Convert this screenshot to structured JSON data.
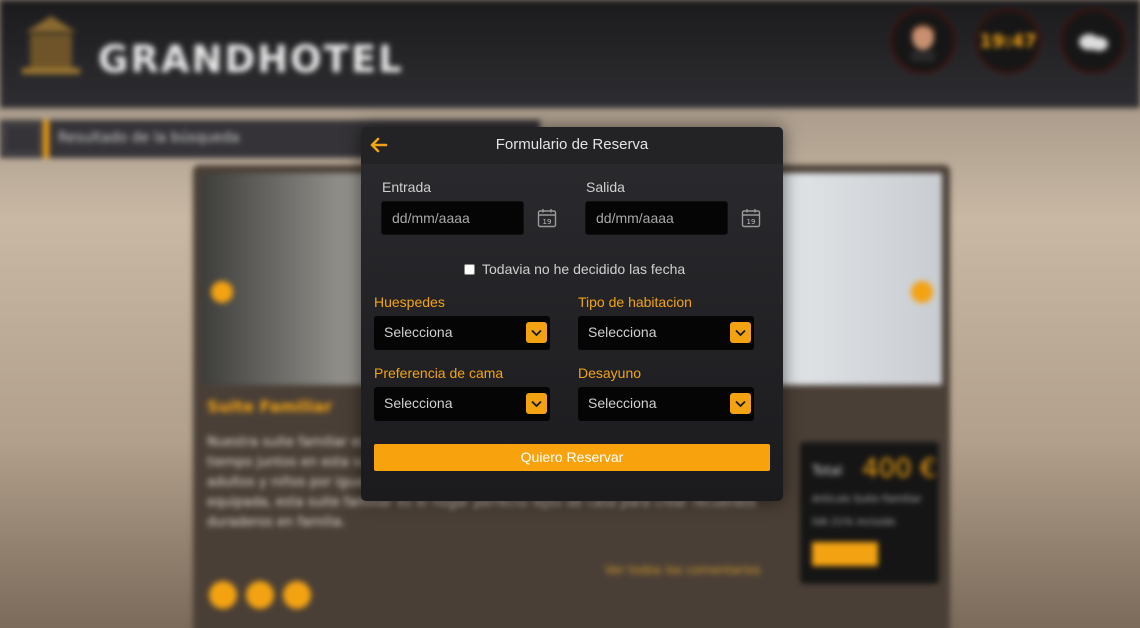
{
  "header": {
    "brand": "GRANDHOTEL",
    "widgets": [
      {
        "name": "user",
        "caption": ""
      },
      {
        "name": "clock",
        "value": "19:47",
        "caption": ""
      },
      {
        "name": "weather",
        "caption": ""
      }
    ]
  },
  "background": {
    "results_label": "Resultado de la búsqueda",
    "room_title": "Suite Familiar",
    "description": "Nuestra suite familiar es perfecta para sus vacaciones inolvidables. Disfrute de su tiempo juntos en esta suite, la suite garantiza una estancia cómoda y placentera para adultos y niños por igual. Desde su amplio salón hasta su cocina completamente equipada, esta suite familiar es el hogar perfecto lejos de casa para crear recuerdos duraderos en familia.",
    "reviews_link": "Ver todos los comentarios",
    "price_label": "Total",
    "price": "400 €",
    "price_rows": [
      "Artículo Suite Familiar",
      "IVA 21% incluido"
    ],
    "book_small": "Reservar"
  },
  "modal": {
    "title": "Formulario de Reserva",
    "entrada_label": "Entrada",
    "salida_label": "Salida",
    "date_placeholder": "dd/mm/aaaa",
    "calendar_day": "19",
    "undecided_label": "Todavia no he decidido las fecha",
    "huespedes_label": "Huespedes",
    "tipo_label": "Tipo de habitacion",
    "cama_label": "Preferencia de cama",
    "desayuno_label": "Desayuno",
    "select_default": "Selecciona",
    "submit_label": "Quiero Reservar"
  },
  "colors": {
    "accent": "#f3a312",
    "modal_bg": "#202023",
    "input_bg": "#050505"
  },
  "icons": {
    "back": "arrow-left-icon",
    "calendar": "calendar-icon",
    "chevron": "chevron-down-icon"
  }
}
